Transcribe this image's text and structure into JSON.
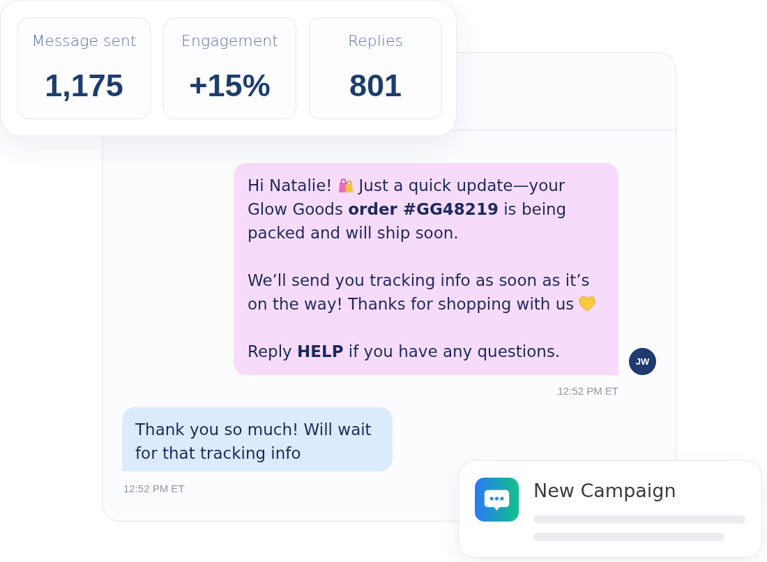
{
  "stats": [
    {
      "label": "Message sent",
      "value": "1,175"
    },
    {
      "label": "Engagement",
      "value": "+15%"
    },
    {
      "label": "Replies",
      "value": "801"
    }
  ],
  "conversation": {
    "messages": [
      {
        "kind": "outgoing",
        "paragraphs": [
          {
            "lines": [
              {
                "segments": [
                  {
                    "kind": "text",
                    "text": "Hi Natalie!"
                  },
                  {
                    "kind": "bags"
                  },
                  {
                    "kind": "text",
                    "text": "Just a quick update—your"
                  }
                ]
              },
              {
                "segments": [
                  {
                    "kind": "text",
                    "text": "Glow Goods **order #GG48219** is being"
                  }
                ]
              },
              {
                "segments": [
                  {
                    "kind": "text",
                    "text": "packed and will ship soon."
                  }
                ]
              }
            ]
          },
          {
            "lines": [
              {
                "segments": [
                  {
                    "kind": "text",
                    "text": "We’ll send you tracking info as soon as it’s"
                  }
                ]
              },
              {
                "segments": [
                  {
                    "kind": "text",
                    "text": "on the way! Thanks for shopping with us"
                  },
                  {
                    "kind": "heart"
                  }
                ]
              }
            ]
          },
          {
            "lines": [
              {
                "segments": [
                  {
                    "kind": "text",
                    "text": "Reply **HELP** if you have any questions."
                  }
                ]
              }
            ]
          }
        ],
        "avatar": "JW",
        "time": "12:52 PM ET"
      },
      {
        "kind": "incoming",
        "text": "Thank you so much! Will wait for that tracking info",
        "time": "12:52 PM ET"
      }
    ]
  },
  "notification": {
    "title": "New Campaign"
  }
}
